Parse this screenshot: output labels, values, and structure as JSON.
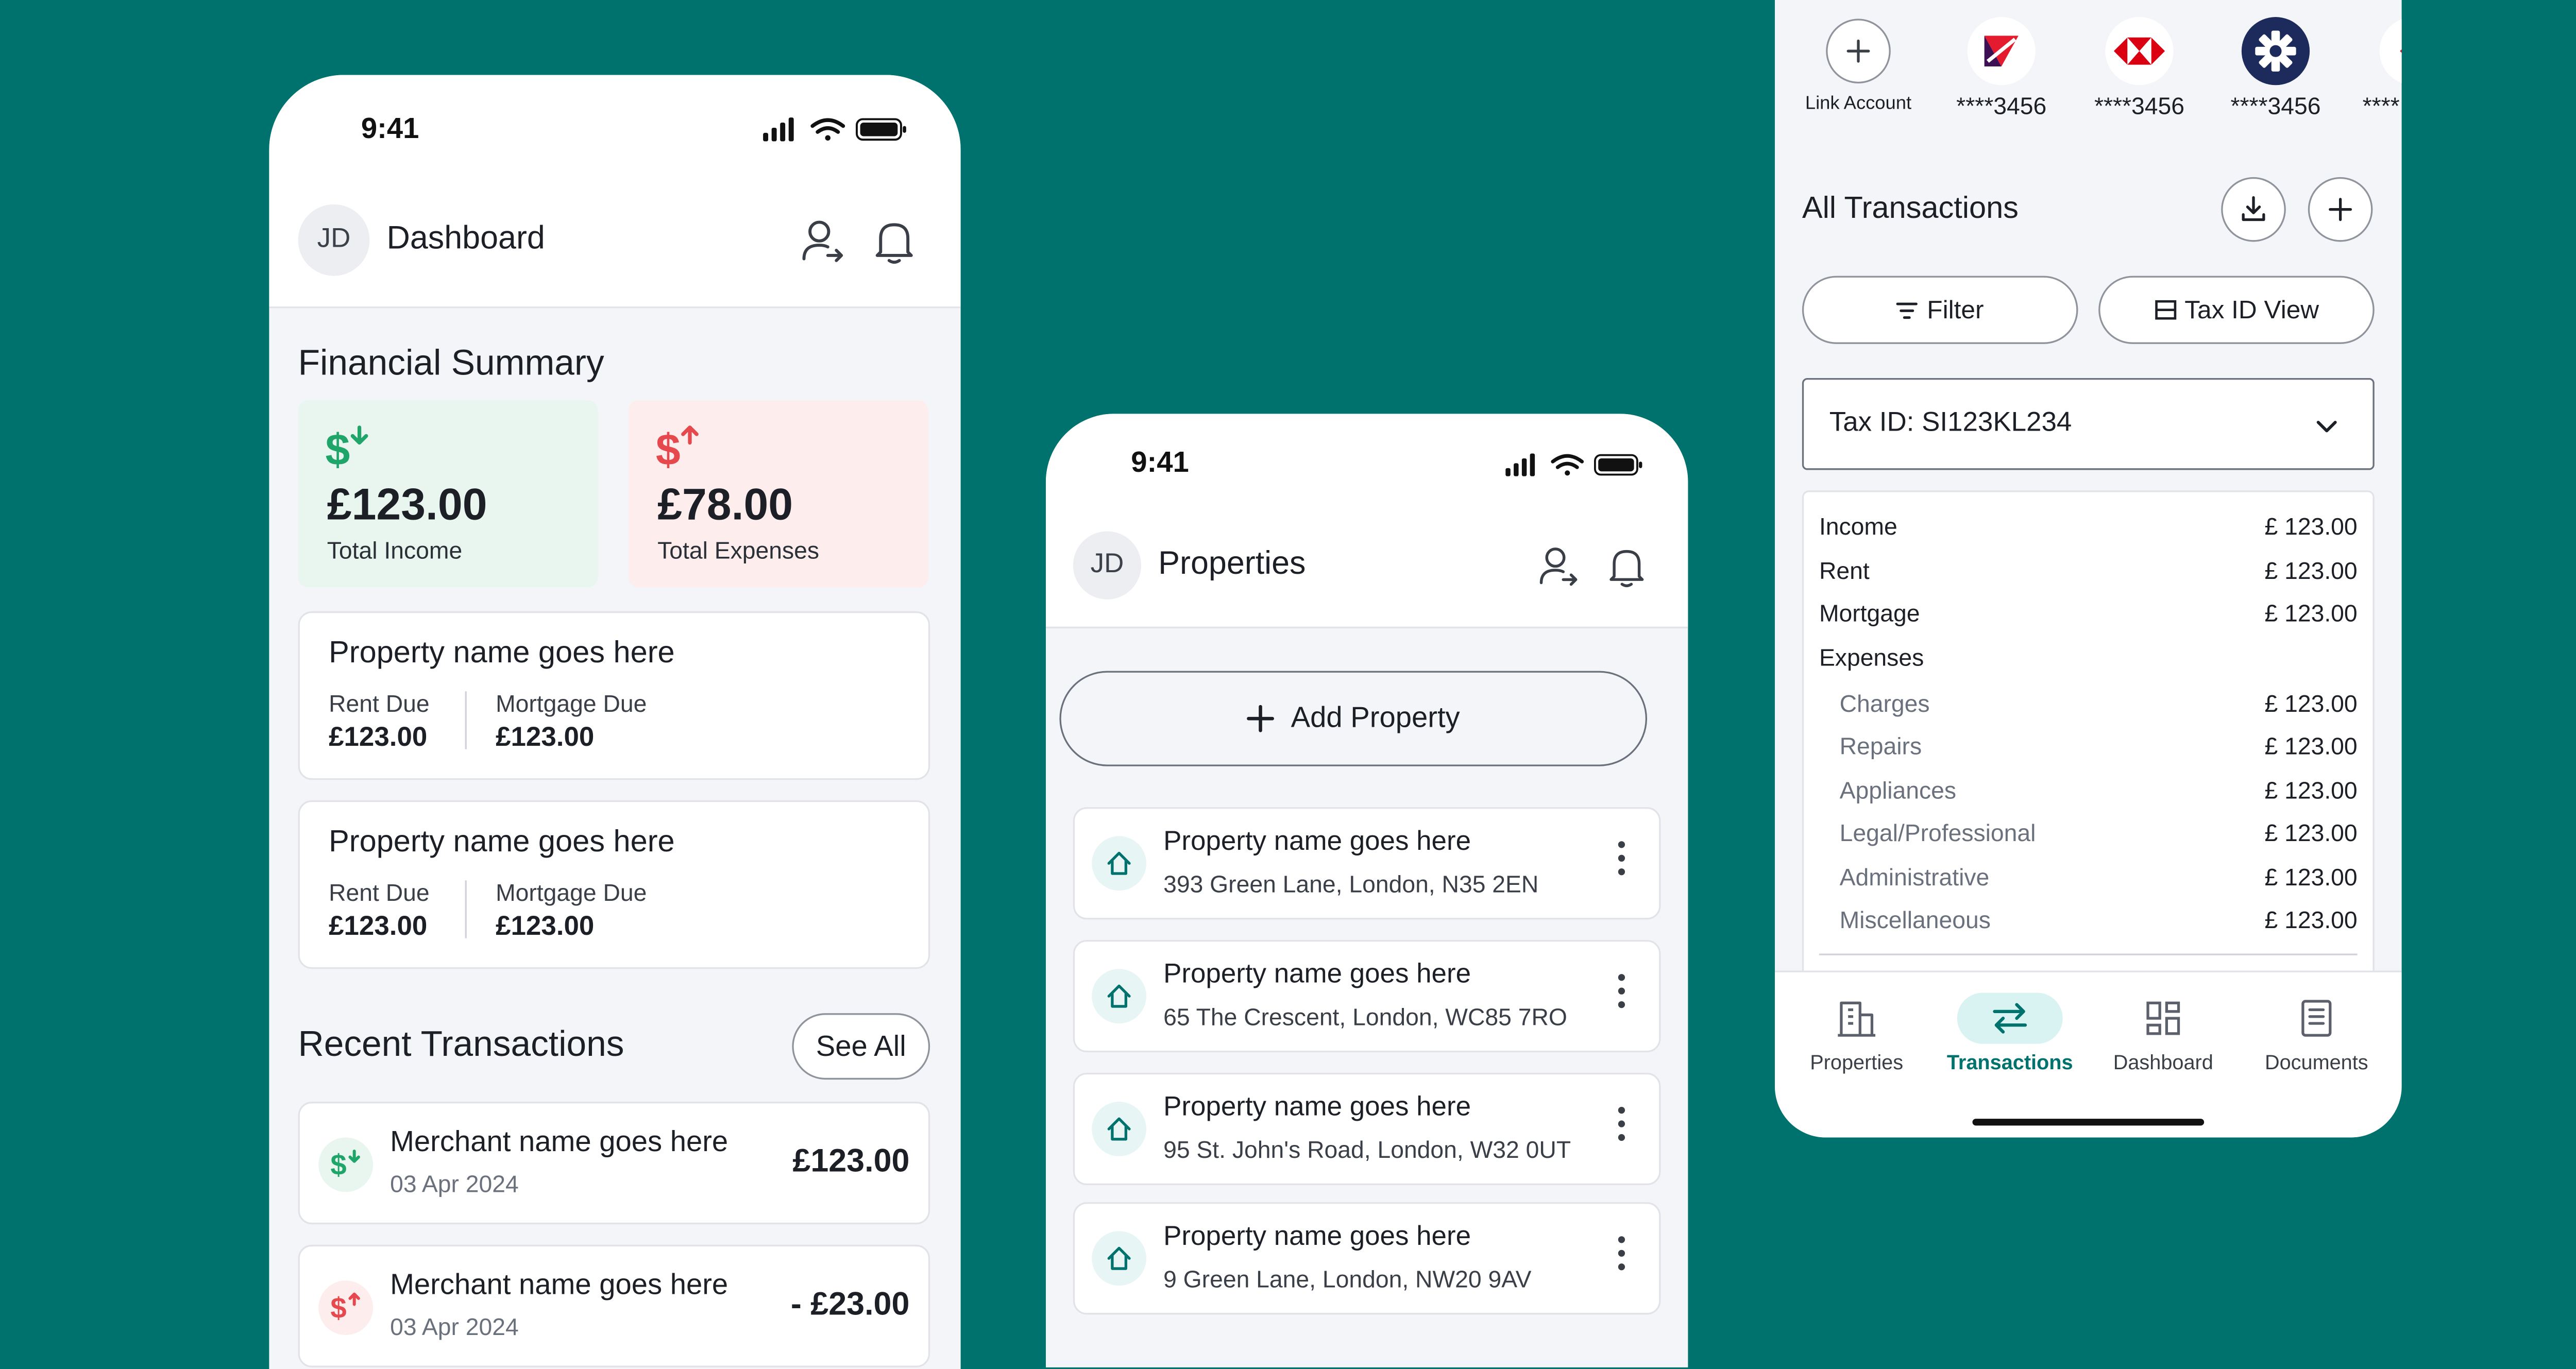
{
  "colors": {
    "background": "#00726D",
    "income_card": "#E8F6EF",
    "expense_card": "#FDEDED",
    "income_icon": "#1FA46A",
    "expense_icon": "#E5484D",
    "accent_teal": "#00726D",
    "active_tab_bg": "#D9F3F2"
  },
  "dashboard": {
    "status_time": "9:41",
    "avatar": "JD",
    "title": "Dashboard",
    "header_icons": [
      "person-switch-icon",
      "bell-icon"
    ],
    "financial_summary": {
      "title": "Financial Summary",
      "income": {
        "amount": "£123.00",
        "label": "Total Income",
        "icon": "dollar-down-icon"
      },
      "expenses": {
        "amount": "£78.00",
        "label": "Total Expenses",
        "icon": "dollar-up-icon"
      }
    },
    "properties": [
      {
        "name": "Property name goes here",
        "rent_label": "Rent Due",
        "rent": "£123.00",
        "mortgage_label": "Mortgage Due",
        "mortgage": "£123.00"
      },
      {
        "name": "Property name goes here",
        "rent_label": "Rent Due",
        "rent": "£123.00",
        "mortgage_label": "Mortgage Due",
        "mortgage": "£123.00"
      }
    ],
    "recent_transactions": {
      "title": "Recent Transactions",
      "see_all": "See All",
      "items": [
        {
          "merchant": "Merchant name goes here",
          "date": "03 Apr 2024",
          "amount": "£123.00",
          "type": "income"
        },
        {
          "merchant": "Merchant name goes here",
          "date": "03 Apr 2024",
          "amount": "- £23.00",
          "type": "expense"
        }
      ]
    }
  },
  "properties_screen": {
    "status_time": "9:41",
    "avatar": "JD",
    "title": "Properties",
    "add_button": "Add Property",
    "items": [
      {
        "name": "Property name goes here",
        "address": "393 Green Lane, London, N35 2EN"
      },
      {
        "name": "Property name goes here",
        "address": "65 The Crescent, London, WC85 7RO"
      },
      {
        "name": "Property name goes here",
        "address": "95 St. John's Road, London, W32 0UT"
      },
      {
        "name": "Property name goes here",
        "address": "9 Green Lane, London, NW20 9AV"
      }
    ]
  },
  "transactions_screen": {
    "link_account": "Link Account",
    "banks": [
      {
        "name": "natwest-logo",
        "mask": "****3456"
      },
      {
        "name": "hsbc-logo",
        "mask": "****3456"
      },
      {
        "name": "rbs-logo",
        "mask": "****3456"
      },
      {
        "name": "partial-bank-logo",
        "mask": "****"
      }
    ],
    "title": "All Transactions",
    "filter": "Filter",
    "tax_view": "Tax ID View",
    "tax_select": "Tax ID: SI123KL234",
    "rows": [
      {
        "label": "Income",
        "value": "£ 123.00",
        "sub": false
      },
      {
        "label": "Rent",
        "value": "£ 123.00",
        "sub": false
      },
      {
        "label": "Mortgage",
        "value": "£ 123.00",
        "sub": false
      },
      {
        "label": "Expenses",
        "value": "",
        "sub": false
      },
      {
        "label": "Charges",
        "value": "£ 123.00",
        "sub": true
      },
      {
        "label": "Repairs",
        "value": "£ 123.00",
        "sub": true
      },
      {
        "label": "Appliances",
        "value": "£ 123.00",
        "sub": true
      },
      {
        "label": "Legal/Professional",
        "value": "£ 123.00",
        "sub": true
      },
      {
        "label": "Administrative",
        "value": "£ 123.00",
        "sub": true
      },
      {
        "label": "Miscellaneous",
        "value": "£ 123.00",
        "sub": true
      }
    ],
    "nav": [
      {
        "label": "Properties",
        "icon": "building-icon",
        "active": false
      },
      {
        "label": "Transactions",
        "icon": "transfer-arrows-icon",
        "active": true
      },
      {
        "label": "Dashboard",
        "icon": "grid-icon",
        "active": false
      },
      {
        "label": "Documents",
        "icon": "document-icon",
        "active": false
      }
    ]
  }
}
